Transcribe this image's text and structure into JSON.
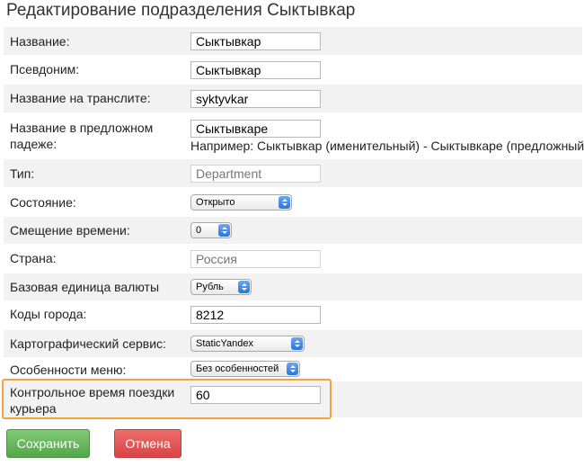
{
  "title": "Редактирование подразделения Сыктывкар",
  "fields": {
    "name": {
      "label": "Название:",
      "value": "Сыктывкар"
    },
    "alias": {
      "label": "Псевдоним:",
      "value": "Сыктывкар"
    },
    "translit": {
      "label": "Название на транслите:",
      "value": "syktyvkar"
    },
    "prepositional": {
      "label_line1": "Название в предложном",
      "label_line2": "падеже:",
      "value": "Сыктывкаре",
      "hint": "Например: Сыктывкар (именительный) - Сыктывкаре (предложный)"
    },
    "type": {
      "label": "Тип:",
      "value": "Department"
    },
    "state": {
      "label": "Состояние:",
      "value": "Открыто"
    },
    "time_offset": {
      "label": "Смещение времени:",
      "value": "0"
    },
    "country": {
      "label": "Страна:",
      "value": "Россия"
    },
    "currency": {
      "label": "Базовая единица валюты",
      "value": "Рубль"
    },
    "city_codes": {
      "label": "Коды города:",
      "value": "8212"
    },
    "map_service": {
      "label": "Картографический сервис:",
      "value": "StaticYandex"
    },
    "menu_features": {
      "label": "Особенности меню:",
      "value": "Без особенностей"
    },
    "courier_time": {
      "label_line1": "Контрольное время поездки",
      "label_line2": "курьера",
      "value": "60"
    }
  },
  "buttons": {
    "save": "Сохранить",
    "cancel": "Отмена"
  },
  "colors": {
    "row_stripe": "#f2f2f2",
    "highlight": "#f4a23a",
    "save_button": "#5cb85c",
    "cancel_button": "#d9534f",
    "select_arrow": "#2a74e0"
  }
}
